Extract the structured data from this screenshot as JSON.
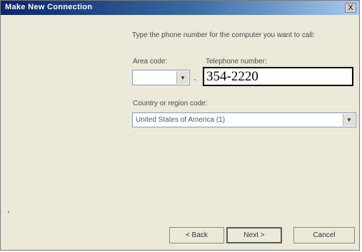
{
  "window": {
    "title": "Make New Connection",
    "close_label": "X"
  },
  "page": {
    "instruction": "Type the phone number for the computer you want to call:",
    "area_code_label": "Area code:",
    "area_code_value": "",
    "phone_label": "Telephone number:",
    "phone_value": "354-2220",
    "country_label": "Country or region code:",
    "country_value": "United States of America (1)"
  },
  "buttons": {
    "back_label": "< Back",
    "next_label": "Next >",
    "cancel_label": "Cancel"
  }
}
